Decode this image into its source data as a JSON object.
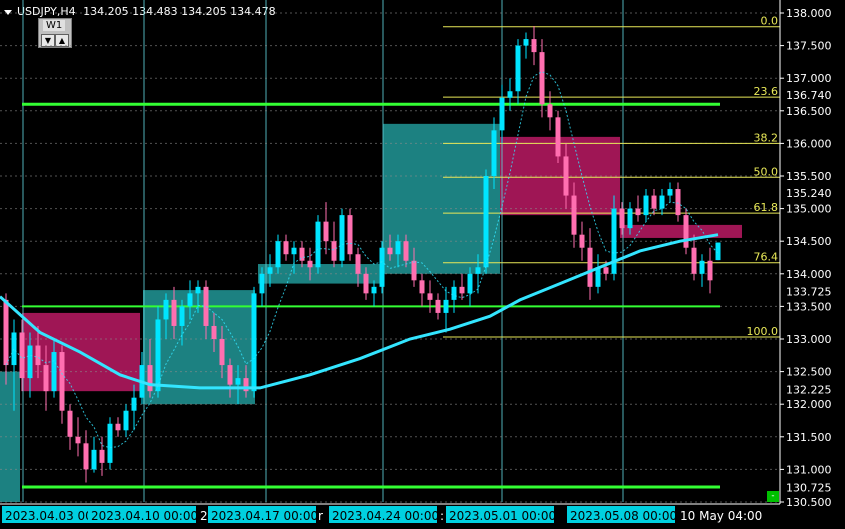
{
  "header": {
    "symbol_label": "USDJPY,H4",
    "ohlc_text": "134.205 134.483 134.205 134.478"
  },
  "panel": {
    "label": "W1",
    "up_glyph": "▲",
    "down_glyph": "▼"
  },
  "colors": {
    "background": "#000000",
    "price_scale_line": "#ffffff",
    "fib_level": "#e8e858",
    "fib_text": "#e8e858",
    "support_resistance": "#33ff33",
    "bull_candle": "#00e5ff",
    "bear_candle": "#ff6fb0",
    "ma_line": "#33e5ff",
    "bull_zone": "#1f8f8f",
    "bear_zone": "#b0185e",
    "vertical_grid": "#5fd0d8",
    "date_label_bg": "#00d0e0",
    "date_label_text": "#000000"
  },
  "chart_data": {
    "type": "candlestick",
    "symbol": "USDJPY",
    "timeframe": "H4",
    "ylim": [
      130.5,
      138.0
    ],
    "y_ticks": [
      "138.000",
      "137.500",
      "137.000",
      "136.500",
      "136.000",
      "135.500",
      "135.000",
      "134.500",
      "134.000",
      "133.500",
      "133.000",
      "132.500",
      "132.000",
      "131.500",
      "131.000",
      "130.500"
    ],
    "y_tick_values": [
      138.0,
      137.5,
      137.0,
      136.5,
      136.0,
      135.5,
      135.0,
      134.5,
      134.0,
      133.5,
      133.0,
      132.5,
      132.0,
      131.5,
      131.0,
      130.5
    ],
    "price_markers": [
      {
        "label": "136.740",
        "value": 136.74
      },
      {
        "label": "135.240",
        "value": 135.24
      },
      {
        "label": "133.725",
        "value": 133.725
      },
      {
        "label": "132.225",
        "value": 132.225
      },
      {
        "label": "130.725",
        "value": 130.725
      }
    ],
    "fib_levels": [
      {
        "label": "0.0",
        "value": 137.79
      },
      {
        "label": "23.6",
        "value": 136.71
      },
      {
        "label": "38.2",
        "value": 136.0
      },
      {
        "label": "50.0",
        "value": 135.48
      },
      {
        "label": "61.8",
        "value": 134.93
      },
      {
        "label": "76.4",
        "value": 134.17
      },
      {
        "label": "100.0",
        "value": 133.03
      }
    ],
    "horizontal_lines": [
      {
        "value": 136.6
      },
      {
        "value": 133.5
      },
      {
        "value": 130.73
      }
    ],
    "x_labels": [
      "2023.04.03 00:00",
      "2023.04.10 00:00",
      "2023.04.17 00:00",
      "2023.04.24 00:00",
      "2023.05.01 00:00",
      "2023.05.08 00:00",
      "10 May 04:00"
    ],
    "x_label_fragments": [
      "2",
      "r",
      ":"
    ],
    "candles": [
      {
        "x": 6,
        "o": 133.6,
        "h": 133.7,
        "l": 132.3,
        "c": 132.6
      },
      {
        "x": 14,
        "o": 132.6,
        "h": 133.3,
        "l": 131.9,
        "c": 133.1
      },
      {
        "x": 22,
        "o": 133.1,
        "h": 133.3,
        "l": 132.2,
        "c": 132.4
      },
      {
        "x": 30,
        "o": 132.4,
        "h": 133.1,
        "l": 132.1,
        "c": 132.9
      },
      {
        "x": 38,
        "o": 132.9,
        "h": 133.2,
        "l": 132.4,
        "c": 132.6
      },
      {
        "x": 46,
        "o": 132.6,
        "h": 132.9,
        "l": 131.9,
        "c": 132.2
      },
      {
        "x": 54,
        "o": 132.2,
        "h": 133.0,
        "l": 132.1,
        "c": 132.8
      },
      {
        "x": 62,
        "o": 132.8,
        "h": 132.9,
        "l": 131.7,
        "c": 131.9
      },
      {
        "x": 70,
        "o": 131.9,
        "h": 132.0,
        "l": 131.3,
        "c": 131.5
      },
      {
        "x": 78,
        "o": 131.5,
        "h": 131.8,
        "l": 131.2,
        "c": 131.4
      },
      {
        "x": 86,
        "o": 131.4,
        "h": 131.6,
        "l": 130.8,
        "c": 131.0
      },
      {
        "x": 94,
        "o": 131.0,
        "h": 131.5,
        "l": 130.95,
        "c": 131.3
      },
      {
        "x": 102,
        "o": 131.3,
        "h": 131.5,
        "l": 130.9,
        "c": 131.1
      },
      {
        "x": 110,
        "o": 131.1,
        "h": 131.8,
        "l": 131.0,
        "c": 131.7
      },
      {
        "x": 118,
        "o": 131.7,
        "h": 131.8,
        "l": 131.5,
        "c": 131.6
      },
      {
        "x": 126,
        "o": 131.6,
        "h": 132.0,
        "l": 131.5,
        "c": 131.9
      },
      {
        "x": 134,
        "o": 131.9,
        "h": 132.3,
        "l": 131.6,
        "c": 132.1
      },
      {
        "x": 142,
        "o": 132.1,
        "h": 132.8,
        "l": 132.0,
        "c": 132.6
      },
      {
        "x": 150,
        "o": 132.6,
        "h": 133.0,
        "l": 132.1,
        "c": 132.2
      },
      {
        "x": 158,
        "o": 132.2,
        "h": 133.5,
        "l": 132.1,
        "c": 133.3
      },
      {
        "x": 166,
        "o": 133.3,
        "h": 133.7,
        "l": 133.0,
        "c": 133.6
      },
      {
        "x": 174,
        "o": 133.6,
        "h": 133.8,
        "l": 133.0,
        "c": 133.2
      },
      {
        "x": 182,
        "o": 133.2,
        "h": 133.6,
        "l": 132.9,
        "c": 133.5
      },
      {
        "x": 190,
        "o": 133.5,
        "h": 133.9,
        "l": 133.3,
        "c": 133.7
      },
      {
        "x": 198,
        "o": 133.7,
        "h": 133.9,
        "l": 133.4,
        "c": 133.8
      },
      {
        "x": 206,
        "o": 133.8,
        "h": 133.9,
        "l": 133.0,
        "c": 133.2
      },
      {
        "x": 214,
        "o": 133.2,
        "h": 133.4,
        "l": 132.8,
        "c": 133.0
      },
      {
        "x": 222,
        "o": 133.0,
        "h": 133.2,
        "l": 132.4,
        "c": 132.6
      },
      {
        "x": 230,
        "o": 132.6,
        "h": 132.7,
        "l": 132.1,
        "c": 132.3
      },
      {
        "x": 238,
        "o": 132.3,
        "h": 132.6,
        "l": 132.0,
        "c": 132.4
      },
      {
        "x": 246,
        "o": 132.4,
        "h": 132.6,
        "l": 132.1,
        "c": 132.2
      },
      {
        "x": 254,
        "o": 132.2,
        "h": 133.8,
        "l": 132.1,
        "c": 133.7
      },
      {
        "x": 262,
        "o": 133.7,
        "h": 134.1,
        "l": 133.5,
        "c": 134.0
      },
      {
        "x": 270,
        "o": 134.0,
        "h": 134.3,
        "l": 133.8,
        "c": 134.1
      },
      {
        "x": 278,
        "o": 134.1,
        "h": 134.6,
        "l": 134.0,
        "c": 134.5
      },
      {
        "x": 286,
        "o": 134.5,
        "h": 134.6,
        "l": 134.2,
        "c": 134.3
      },
      {
        "x": 294,
        "o": 134.3,
        "h": 134.5,
        "l": 134.0,
        "c": 134.4
      },
      {
        "x": 302,
        "o": 134.4,
        "h": 134.5,
        "l": 134.1,
        "c": 134.2
      },
      {
        "x": 310,
        "o": 134.2,
        "h": 134.4,
        "l": 133.9,
        "c": 134.1
      },
      {
        "x": 318,
        "o": 134.1,
        "h": 134.9,
        "l": 134.0,
        "c": 134.8
      },
      {
        "x": 326,
        "o": 134.8,
        "h": 135.1,
        "l": 134.3,
        "c": 134.5
      },
      {
        "x": 334,
        "o": 134.5,
        "h": 134.8,
        "l": 134.1,
        "c": 134.2
      },
      {
        "x": 342,
        "o": 134.2,
        "h": 135.0,
        "l": 134.1,
        "c": 134.9
      },
      {
        "x": 350,
        "o": 134.9,
        "h": 135.0,
        "l": 134.2,
        "c": 134.3
      },
      {
        "x": 358,
        "o": 134.3,
        "h": 134.4,
        "l": 133.8,
        "c": 134.0
      },
      {
        "x": 366,
        "o": 134.0,
        "h": 134.1,
        "l": 133.6,
        "c": 133.7
      },
      {
        "x": 374,
        "o": 133.7,
        "h": 133.9,
        "l": 133.5,
        "c": 133.8
      },
      {
        "x": 382,
        "o": 133.8,
        "h": 134.5,
        "l": 133.7,
        "c": 134.4
      },
      {
        "x": 390,
        "o": 134.4,
        "h": 134.6,
        "l": 134.2,
        "c": 134.3
      },
      {
        "x": 398,
        "o": 134.3,
        "h": 134.6,
        "l": 134.1,
        "c": 134.5
      },
      {
        "x": 406,
        "o": 134.5,
        "h": 134.6,
        "l": 134.1,
        "c": 134.2
      },
      {
        "x": 414,
        "o": 134.2,
        "h": 134.4,
        "l": 133.8,
        "c": 133.9
      },
      {
        "x": 422,
        "o": 133.9,
        "h": 134.0,
        "l": 133.5,
        "c": 133.7
      },
      {
        "x": 430,
        "o": 133.7,
        "h": 133.9,
        "l": 133.4,
        "c": 133.6
      },
      {
        "x": 438,
        "o": 133.6,
        "h": 133.7,
        "l": 133.3,
        "c": 133.4
      },
      {
        "x": 446,
        "o": 133.4,
        "h": 133.8,
        "l": 133.1,
        "c": 133.6
      },
      {
        "x": 454,
        "o": 133.6,
        "h": 133.9,
        "l": 133.4,
        "c": 133.8
      },
      {
        "x": 462,
        "o": 133.8,
        "h": 134.0,
        "l": 133.6,
        "c": 133.7
      },
      {
        "x": 470,
        "o": 133.7,
        "h": 134.1,
        "l": 133.5,
        "c": 134.0
      },
      {
        "x": 478,
        "o": 134.0,
        "h": 134.3,
        "l": 133.7,
        "c": 134.1
      },
      {
        "x": 486,
        "o": 134.1,
        "h": 135.6,
        "l": 134.0,
        "c": 135.5
      },
      {
        "x": 494,
        "o": 135.5,
        "h": 136.4,
        "l": 135.3,
        "c": 136.2
      },
      {
        "x": 502,
        "o": 136.2,
        "h": 136.9,
        "l": 136.0,
        "c": 136.7
      },
      {
        "x": 510,
        "o": 136.7,
        "h": 137.0,
        "l": 136.5,
        "c": 136.8
      },
      {
        "x": 518,
        "o": 136.8,
        "h": 137.6,
        "l": 136.6,
        "c": 137.5
      },
      {
        "x": 526,
        "o": 137.5,
        "h": 137.7,
        "l": 137.3,
        "c": 137.6
      },
      {
        "x": 534,
        "o": 137.6,
        "h": 137.8,
        "l": 137.2,
        "c": 137.4
      },
      {
        "x": 542,
        "o": 137.4,
        "h": 137.6,
        "l": 136.4,
        "c": 136.6
      },
      {
        "x": 550,
        "o": 136.6,
        "h": 136.8,
        "l": 136.2,
        "c": 136.4
      },
      {
        "x": 558,
        "o": 136.4,
        "h": 136.5,
        "l": 135.7,
        "c": 135.8
      },
      {
        "x": 566,
        "o": 135.8,
        "h": 136.0,
        "l": 135.0,
        "c": 135.2
      },
      {
        "x": 574,
        "o": 135.2,
        "h": 135.4,
        "l": 134.4,
        "c": 134.6
      },
      {
        "x": 582,
        "o": 134.6,
        "h": 134.8,
        "l": 134.2,
        "c": 134.4
      },
      {
        "x": 590,
        "o": 134.4,
        "h": 134.7,
        "l": 133.6,
        "c": 133.8
      },
      {
        "x": 598,
        "o": 133.8,
        "h": 134.3,
        "l": 133.7,
        "c": 134.1
      },
      {
        "x": 606,
        "o": 134.1,
        "h": 134.2,
        "l": 133.9,
        "c": 134.0
      },
      {
        "x": 614,
        "o": 134.0,
        "h": 135.2,
        "l": 133.9,
        "c": 135.0
      },
      {
        "x": 622,
        "o": 135.0,
        "h": 135.1,
        "l": 134.6,
        "c": 134.7
      },
      {
        "x": 630,
        "o": 134.7,
        "h": 135.1,
        "l": 134.6,
        "c": 135.0
      },
      {
        "x": 638,
        "o": 135.0,
        "h": 135.2,
        "l": 134.8,
        "c": 134.9
      },
      {
        "x": 646,
        "o": 134.9,
        "h": 135.3,
        "l": 134.8,
        "c": 135.2
      },
      {
        "x": 654,
        "o": 135.2,
        "h": 135.3,
        "l": 134.9,
        "c": 135.0
      },
      {
        "x": 662,
        "o": 135.0,
        "h": 135.3,
        "l": 134.9,
        "c": 135.2
      },
      {
        "x": 670,
        "o": 135.2,
        "h": 135.4,
        "l": 135.1,
        "c": 135.3
      },
      {
        "x": 678,
        "o": 135.3,
        "h": 135.4,
        "l": 134.8,
        "c": 134.9
      },
      {
        "x": 686,
        "o": 134.9,
        "h": 135.0,
        "l": 134.3,
        "c": 134.4
      },
      {
        "x": 694,
        "o": 134.4,
        "h": 134.6,
        "l": 133.9,
        "c": 134.0
      },
      {
        "x": 702,
        "o": 134.0,
        "h": 134.3,
        "l": 133.8,
        "c": 134.2
      },
      {
        "x": 710,
        "o": 134.2,
        "h": 134.4,
        "l": 133.7,
        "c": 133.9
      },
      {
        "x": 718,
        "o": 134.21,
        "h": 134.48,
        "l": 134.21,
        "c": 134.48
      }
    ],
    "moving_average": [
      [
        0,
        133.65
      ],
      [
        40,
        133.1
      ],
      [
        80,
        132.8
      ],
      [
        120,
        132.45
      ],
      [
        150,
        132.3
      ],
      [
        200,
        132.25
      ],
      [
        260,
        132.25
      ],
      [
        310,
        132.45
      ],
      [
        360,
        132.7
      ],
      [
        410,
        133.0
      ],
      [
        450,
        133.15
      ],
      [
        490,
        133.35
      ],
      [
        520,
        133.6
      ],
      [
        560,
        133.85
      ],
      [
        600,
        134.1
      ],
      [
        640,
        134.35
      ],
      [
        680,
        134.5
      ],
      [
        718,
        134.6
      ]
    ],
    "zones": [
      {
        "kind": "bear",
        "x0": 22,
        "x1": 140,
        "y0": 132.2,
        "y1": 133.4
      },
      {
        "kind": "bull",
        "x0": 0,
        "x1": 20,
        "y0": 130.5,
        "y1": 132.5
      },
      {
        "kind": "bull",
        "x0": 143,
        "x1": 255,
        "y0": 132.0,
        "y1": 133.75
      },
      {
        "kind": "bull",
        "x0": 258,
        "x1": 380,
        "y0": 133.85,
        "y1": 134.15
      },
      {
        "kind": "bull",
        "x0": 383,
        "x1": 500,
        "y0": 134.0,
        "y1": 136.3
      },
      {
        "kind": "bear",
        "x0": 500,
        "x1": 620,
        "y0": 134.9,
        "y1": 136.1
      },
      {
        "kind": "bear",
        "x0": 620,
        "x1": 742,
        "y0": 134.55,
        "y1": 134.75
      }
    ],
    "vertical_grid_x": [
      23,
      144,
      266,
      383,
      502,
      623
    ]
  }
}
